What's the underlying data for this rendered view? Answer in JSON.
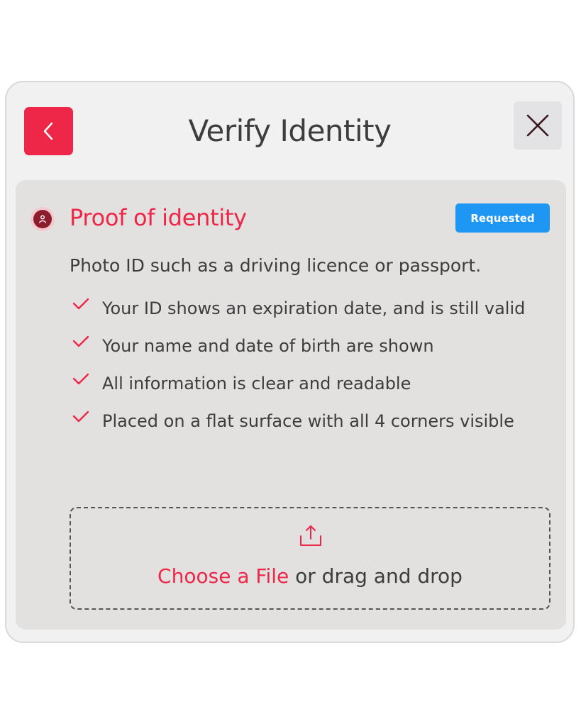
{
  "header": {
    "title": "Verify Identity",
    "back_icon": "chevron-left-icon",
    "close_icon": "close-icon"
  },
  "section": {
    "icon": "person-icon",
    "title": "Proof of identity",
    "status_badge": "Requested",
    "description": "Photo ID such as a driving licence or passport."
  },
  "checklist": [
    "Your ID shows an expiration date, and is still valid",
    "Your name and date of birth are shown",
    "All information is clear and readable",
    "Placed on a flat surface with all 4 corners visible"
  ],
  "upload": {
    "icon": "upload-icon",
    "choose_label": "Choose a File",
    "drag_label": " or drag and drop"
  },
  "colors": {
    "accent": "#ee2748",
    "badge": "#1e96f3",
    "card_background": "#e3e0e0",
    "modal_background": "#f2f1f2"
  }
}
